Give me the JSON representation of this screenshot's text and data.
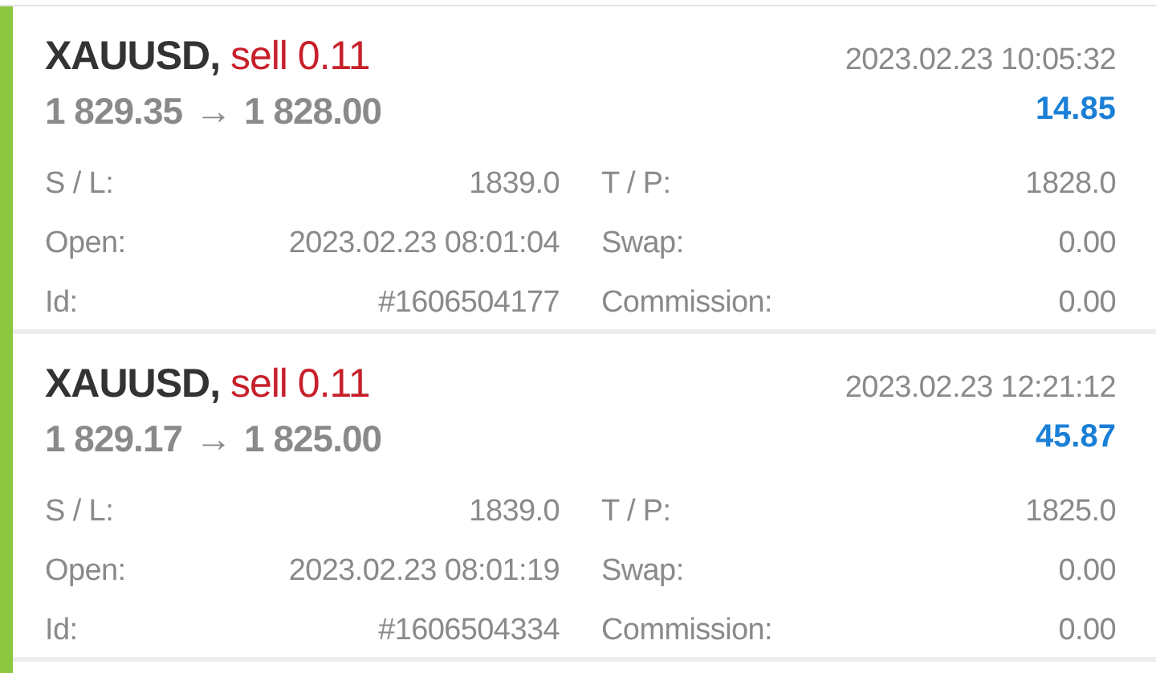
{
  "trades": [
    {
      "symbol": "XAUUSD,",
      "action": "sell 0.11",
      "time": "2023.02.23 10:05:32",
      "open_price": "1 829.35",
      "arrow": "→",
      "close_price": "1 828.00",
      "profit": "14.85",
      "details": [
        {
          "label": "S / L:",
          "value": "1839.0"
        },
        {
          "label": "T / P:",
          "value": "1828.0"
        },
        {
          "label": "Open:",
          "value": "2023.02.23 08:01:04"
        },
        {
          "label": "Swap:",
          "value": "0.00"
        },
        {
          "label": "Id:",
          "value": "#1606504177"
        },
        {
          "label": "Commission:",
          "value": "0.00"
        }
      ]
    },
    {
      "symbol": "XAUUSD,",
      "action": "sell 0.11",
      "time": "2023.02.23 12:21:12",
      "open_price": "1 829.17",
      "arrow": "→",
      "close_price": "1 825.00",
      "profit": "45.87",
      "details": [
        {
          "label": "S / L:",
          "value": "1839.0"
        },
        {
          "label": "T / P:",
          "value": "1825.0"
        },
        {
          "label": "Open:",
          "value": "2023.02.23 08:01:19"
        },
        {
          "label": "Swap:",
          "value": "0.00"
        },
        {
          "label": "Id:",
          "value": "#1606504334"
        },
        {
          "label": "Commission:",
          "value": "0.00"
        }
      ]
    }
  ]
}
